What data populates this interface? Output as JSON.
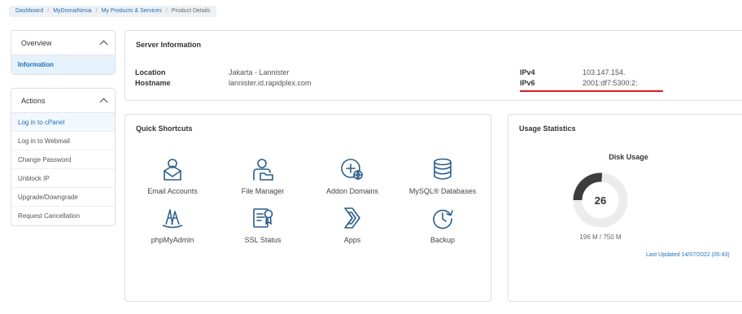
{
  "breadcrumb": {
    "items": [
      "Dashboard",
      "MyDomaiNesia",
      "My Products & Services"
    ],
    "current": "Product Details"
  },
  "sidebar": {
    "overview": {
      "title": "Overview",
      "items": [
        {
          "label": "Information"
        }
      ]
    },
    "actions": {
      "title": "Actions",
      "items": [
        {
          "label": "Log in to cPanel"
        },
        {
          "label": "Log in to Webmail"
        },
        {
          "label": "Change Password"
        },
        {
          "label": "Unblock IP"
        },
        {
          "label": "Upgrade/Downgrade"
        },
        {
          "label": "Request Cancellation"
        }
      ]
    }
  },
  "server_info": {
    "title": "Server Information",
    "location_label": "Location",
    "location_value": "Jakarta - Lannister",
    "hostname_label": "Hostname",
    "hostname_value": "lannister.id.rapidplex.com",
    "ipv4_label": "IPv4",
    "ipv4_value": "103.147.154.",
    "ipv6_label": "IPv6",
    "ipv6_value": "2001:df7:5300:2:",
    "accent_color": "#e01b1b"
  },
  "quick_shortcuts": {
    "title": "Quick Shortcuts",
    "icon_color": "#2a5d8a",
    "items": [
      {
        "label": "Email Accounts",
        "icon": "email-accounts-icon"
      },
      {
        "label": "File Manager",
        "icon": "file-manager-icon"
      },
      {
        "label": "Addon Domains",
        "icon": "addon-domains-icon"
      },
      {
        "label": "MySQL® Databases",
        "icon": "database-icon"
      },
      {
        "label": "phpMyAdmin",
        "icon": "phpmyadmin-icon"
      },
      {
        "label": "SSL Status",
        "icon": "ssl-status-icon"
      },
      {
        "label": "Apps",
        "icon": "apps-icon"
      },
      {
        "label": "Backup",
        "icon": "backup-icon"
      }
    ]
  },
  "usage": {
    "title": "Usage Statistics",
    "disk_title": "Disk Usage",
    "percent": 26,
    "size_text": "196 M / 750 M",
    "last_updated": "Last Updated 14/07/2022 (05:43)",
    "gauge_fill_color": "#3d3d3d",
    "gauge_track_color": "#ececec"
  }
}
